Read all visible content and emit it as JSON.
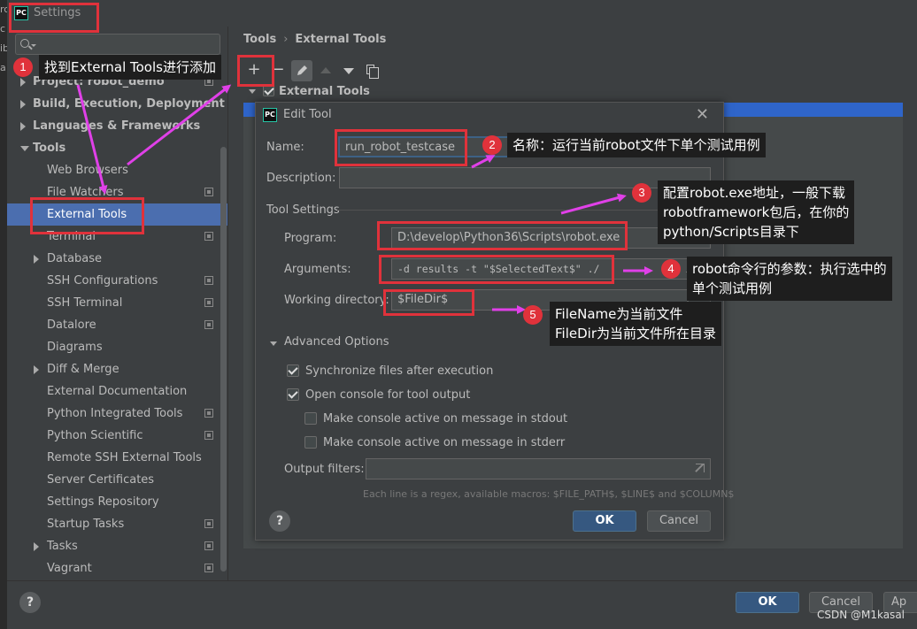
{
  "window": {
    "title": "Settings",
    "app_icon": "PC"
  },
  "edge_letters": [
    "rc",
    "c",
    "ib",
    "a"
  ],
  "sidebar": {
    "search_placeholder": "",
    "items": [
      {
        "label": "Project: robot_demo",
        "bold": true,
        "arrow": "right",
        "indent": 0,
        "icon": true
      },
      {
        "label": "Build, Execution, Deployment",
        "bold": true,
        "arrow": "right",
        "indent": 0,
        "icon": false
      },
      {
        "label": "Languages & Frameworks",
        "bold": true,
        "arrow": "right",
        "indent": 0,
        "icon": false
      },
      {
        "label": "Tools",
        "bold": true,
        "arrow": "down",
        "indent": 0,
        "icon": false
      },
      {
        "label": "Web Browsers",
        "bold": false,
        "arrow": "",
        "indent": 1,
        "icon": false
      },
      {
        "label": "File Watchers",
        "bold": false,
        "arrow": "",
        "indent": 1,
        "icon": true
      },
      {
        "label": "External Tools",
        "bold": false,
        "arrow": "",
        "indent": 1,
        "icon": false,
        "selected": true
      },
      {
        "label": "Terminal",
        "bold": false,
        "arrow": "",
        "indent": 1,
        "icon": true
      },
      {
        "label": "Database",
        "bold": false,
        "arrow": "right",
        "indent": 1,
        "icon": false
      },
      {
        "label": "SSH Configurations",
        "bold": false,
        "arrow": "",
        "indent": 1,
        "icon": true
      },
      {
        "label": "SSH Terminal",
        "bold": false,
        "arrow": "",
        "indent": 1,
        "icon": true
      },
      {
        "label": "Datalore",
        "bold": false,
        "arrow": "",
        "indent": 1,
        "icon": true
      },
      {
        "label": "Diagrams",
        "bold": false,
        "arrow": "",
        "indent": 1,
        "icon": false
      },
      {
        "label": "Diff & Merge",
        "bold": false,
        "arrow": "right",
        "indent": 1,
        "icon": false
      },
      {
        "label": "External Documentation",
        "bold": false,
        "arrow": "",
        "indent": 1,
        "icon": false
      },
      {
        "label": "Python Integrated Tools",
        "bold": false,
        "arrow": "",
        "indent": 1,
        "icon": true
      },
      {
        "label": "Python Scientific",
        "bold": false,
        "arrow": "",
        "indent": 1,
        "icon": true
      },
      {
        "label": "Remote SSH External Tools",
        "bold": false,
        "arrow": "",
        "indent": 1,
        "icon": false
      },
      {
        "label": "Server Certificates",
        "bold": false,
        "arrow": "",
        "indent": 1,
        "icon": false
      },
      {
        "label": "Settings Repository",
        "bold": false,
        "arrow": "",
        "indent": 1,
        "icon": false
      },
      {
        "label": "Startup Tasks",
        "bold": false,
        "arrow": "",
        "indent": 1,
        "icon": true
      },
      {
        "label": "Tasks",
        "bold": false,
        "arrow": "right",
        "indent": 1,
        "icon": true
      },
      {
        "label": "Vagrant",
        "bold": false,
        "arrow": "",
        "indent": 1,
        "icon": true
      }
    ]
  },
  "main": {
    "breadcrumb": [
      "Tools",
      "External Tools"
    ],
    "breadcrumb_sep": "›",
    "toolbar": {
      "add": "+",
      "remove": "−"
    },
    "group_label": "External Tools"
  },
  "dialog": {
    "title": "Edit Tool",
    "close": "✕",
    "name_label": "Name:",
    "name_value": "run_robot_testcase",
    "description_label": "Description:",
    "description_value": "",
    "tool_settings_label": "Tool Settings",
    "program_label": "Program:",
    "program_value": "D:\\develop\\Python36\\Scripts\\robot.exe",
    "arguments_label": "Arguments:",
    "arguments_value": "-d results -t \"$SelectedText$\" ./",
    "working_dir_label": "Working directory:",
    "working_dir_value": "$FileDir$",
    "advanced_label": "Advanced Options",
    "options": [
      {
        "label": "Synchronize files after execution",
        "checked": true
      },
      {
        "label": "Open console for tool output",
        "checked": true
      },
      {
        "label": "Make console active on message in stdout",
        "checked": false
      },
      {
        "label": "Make console active on message in stderr",
        "checked": false
      }
    ],
    "output_filters_label": "Output filters:",
    "output_filters_value": "",
    "hint": "Each line is a regex, available macros: $FILE_PATH$, $LINE$ and $COLUMN$",
    "help": "?",
    "ok": "OK",
    "cancel": "Cancel"
  },
  "bottom": {
    "help": "?",
    "ok": "OK",
    "cancel": "Cancel",
    "apply": "Ap"
  },
  "watermark": "CSDN @M1kasal",
  "annotations": {
    "badges": [
      "1",
      "2",
      "3",
      "4",
      "5"
    ],
    "callout1": "找到External Tools进行添加",
    "callout2": "名称：运行当前robot文件下单个测试用例",
    "callout3": [
      "配置robot.exe地址，一般下载",
      "robotframework包后，在你的",
      "python/Scripts目录下"
    ],
    "callout4": [
      "robot命令行的参数：执行选中的",
      "单个测试用例"
    ],
    "callout5": [
      "FileName为当前文件",
      "FileDir为当前文件所在目录"
    ],
    "colors": {
      "red": "#e0323b",
      "arrow": "#e040e8"
    }
  }
}
